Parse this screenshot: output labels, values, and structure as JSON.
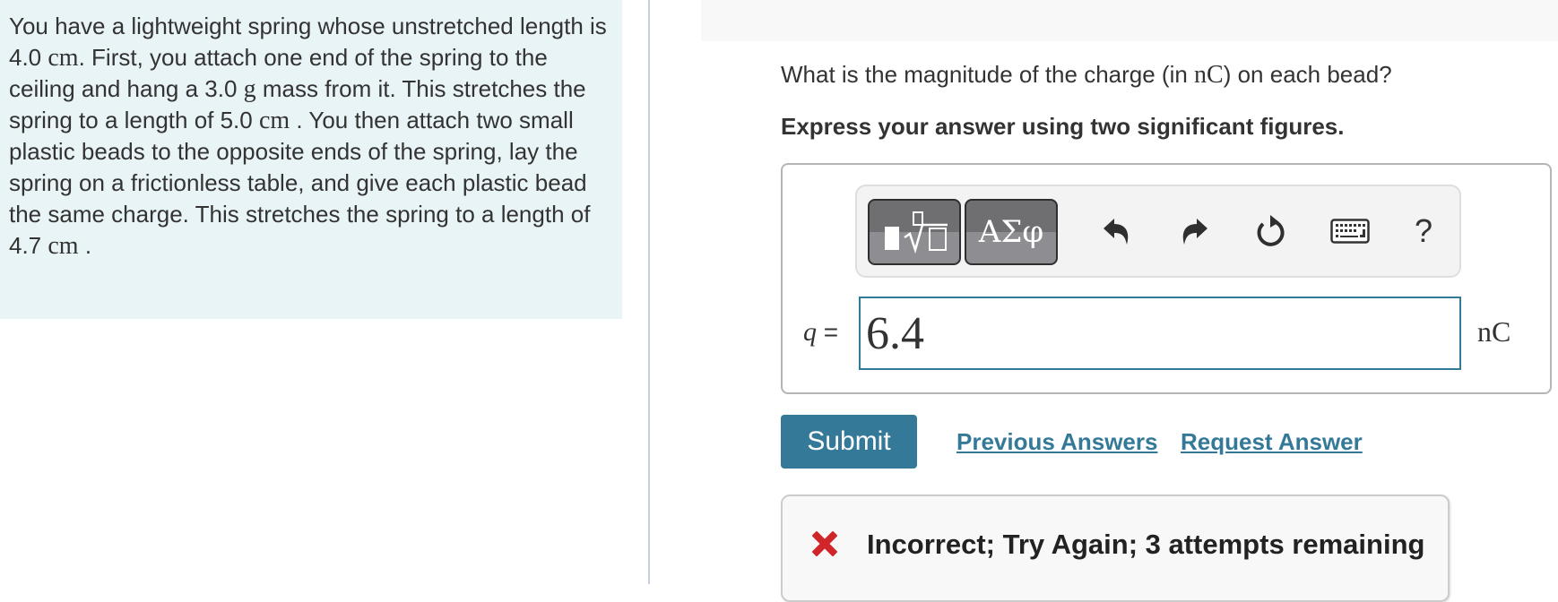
{
  "problem": {
    "segments": [
      {
        "text": "You have a lightweight spring whose unstretched length is 4.0 ",
        "type": "text"
      },
      {
        "text": "cm",
        "type": "unit"
      },
      {
        "text": ". First, you attach one end of the spring to the ceiling and hang a 3.0 ",
        "type": "text"
      },
      {
        "text": "g",
        "type": "unit"
      },
      {
        "text": " mass from it. This stretches the spring to a length of 5.0 ",
        "type": "text"
      },
      {
        "text": "cm",
        "type": "unit"
      },
      {
        "text": " . You then attach two small plastic beads to the opposite ends of the spring, lay the spring on a frictionless table, and give each plastic bead the same charge. This stretches the spring to a length of 4.7 ",
        "type": "text"
      },
      {
        "text": "cm",
        "type": "unit"
      },
      {
        "text": " .",
        "type": "text"
      }
    ]
  },
  "question": {
    "prefix": "What is the magnitude of the charge (in ",
    "unit": "nC",
    "suffix": ") on each bead?"
  },
  "instruction": "Express your answer using two significant figures.",
  "toolbar": {
    "templates_label": "templates",
    "symbols_label": "ΑΣφ",
    "help_label": "?",
    "icons": [
      "templates-icon",
      "greek-symbols-icon",
      "undo-icon",
      "redo-icon",
      "reset-icon",
      "keyboard-icon",
      "help-icon"
    ]
  },
  "answer": {
    "variable": "q",
    "equals": "=",
    "value": "6.4",
    "unit": "nC"
  },
  "actions": {
    "submit_label": "Submit",
    "previous_answers_label": "Previous Answers",
    "request_answer_label": "Request Answer"
  },
  "feedback": {
    "message": "Incorrect; Try Again; 3 attempts remaining",
    "status": "incorrect",
    "status_color": "#d0262a"
  },
  "colors": {
    "accent": "#347a98",
    "problem_bg": "#e9f4f7",
    "error": "#d0262a"
  }
}
